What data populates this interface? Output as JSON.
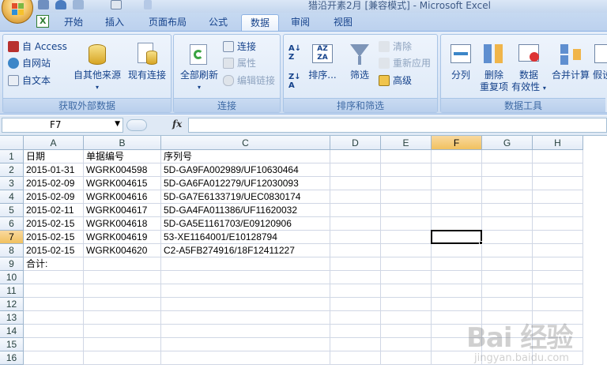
{
  "window": {
    "title": "猎沿开素2月 [兼容模式] - Microsoft Excel"
  },
  "tabs": [
    {
      "label": "开始",
      "active": false
    },
    {
      "label": "插入",
      "active": false
    },
    {
      "label": "页面布局",
      "active": false
    },
    {
      "label": "公式",
      "active": false
    },
    {
      "label": "数据",
      "active": true
    },
    {
      "label": "审阅",
      "active": false
    },
    {
      "label": "视图",
      "active": false
    }
  ],
  "ribbon": {
    "external": {
      "label": "获取外部数据",
      "access": "自 Access",
      "web": "自网站",
      "text": "自文本",
      "other": "自其他来源",
      "existing": "现有连接"
    },
    "connections": {
      "label": "连接",
      "refresh_all": "全部刷新",
      "connections": "连接",
      "properties": "属性",
      "edit_links": "编辑链接"
    },
    "sort_filter": {
      "label": "排序和筛选",
      "sort": "排序...",
      "filter": "筛选",
      "clear": "清除",
      "reapply": "重新应用",
      "advanced": "高级"
    },
    "data_tools": {
      "label": "数据工具",
      "text_to_columns": "分列",
      "remove_duplicates_1": "删除",
      "remove_duplicates_2": "重复项",
      "validation_1": "数据",
      "validation_2": "有效性",
      "consolidate": "合并计算",
      "whatif": "假设"
    }
  },
  "formula_bar": {
    "name_box": "F7",
    "fx_label": "fx",
    "value": ""
  },
  "sheet": {
    "columns": [
      "A",
      "B",
      "C",
      "D",
      "E",
      "F",
      "G",
      "H"
    ],
    "rows": [
      "1",
      "2",
      "3",
      "4",
      "5",
      "6",
      "7",
      "8",
      "9",
      "10",
      "11",
      "12",
      "13",
      "14",
      "15",
      "16"
    ],
    "selected_column": "F",
    "selected_row": "7",
    "cells": [
      [
        "日期",
        "单据编号",
        "序列号"
      ],
      [
        "2015-01-31",
        "WGRK004598",
        "5D-GA9FA002989/UF10630464"
      ],
      [
        "2015-02-09",
        "WGRK004615",
        "5D-GA6FA012279/UF12030093"
      ],
      [
        "2015-02-09",
        "WGRK004616",
        "5D-GA7E6133719/UEC0830174"
      ],
      [
        "2015-02-11",
        "WGRK004617",
        "5D-GA4FA011386/UF11620032"
      ],
      [
        "2015-02-15",
        "WGRK004618",
        "5D-GA5E1161703/E09120906"
      ],
      [
        "2015-02-15",
        "WGRK004619",
        "53-XE1164001/E10128794"
      ],
      [
        "2015-02-15",
        "WGRK004620",
        "C2-A5FB274916/18F12411227"
      ],
      [
        "合计:",
        "",
        ""
      ]
    ]
  },
  "watermark": {
    "main": "Bai 经验",
    "sub": "jingyan.baidu.com"
  }
}
